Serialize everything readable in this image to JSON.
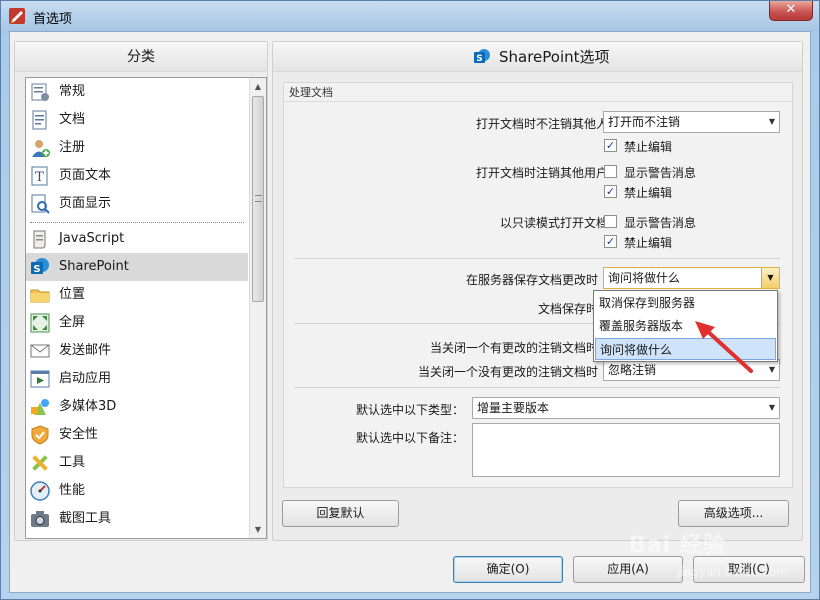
{
  "window": {
    "title": "首选项",
    "close_label": "✕"
  },
  "left": {
    "header": "分类",
    "items": [
      {
        "label": "常规",
        "icon": "settings-list-icon"
      },
      {
        "label": "文档",
        "icon": "document-icon"
      },
      {
        "label": "注册",
        "icon": "user-add-icon"
      },
      {
        "label": "页面文本",
        "icon": "text-icon"
      },
      {
        "label": "页面显示",
        "icon": "page-zoom-icon"
      },
      {
        "label": "JavaScript",
        "icon": "script-icon"
      },
      {
        "label": "SharePoint",
        "icon": "sharepoint-icon"
      },
      {
        "label": "位置",
        "icon": "folder-icon"
      },
      {
        "label": "全屏",
        "icon": "fullscreen-icon"
      },
      {
        "label": "发送邮件",
        "icon": "mail-icon"
      },
      {
        "label": "启动应用",
        "icon": "launch-app-icon"
      },
      {
        "label": "多媒体3D",
        "icon": "shapes-3d-icon"
      },
      {
        "label": "安全性",
        "icon": "shield-icon"
      },
      {
        "label": "工具",
        "icon": "tools-icon"
      },
      {
        "label": "性能",
        "icon": "gauge-icon"
      },
      {
        "label": "截图工具",
        "icon": "camera-icon"
      }
    ]
  },
  "right": {
    "header": "SharePoint选项",
    "group_title": "处理文档",
    "row1": {
      "label": "打开文档时不注销其他人",
      "value": "打开而不注销",
      "chk_label": "禁止编辑",
      "checked": true
    },
    "row2": {
      "label": "打开文档时注销其他用户",
      "chk1_label": "显示警告消息",
      "chk1": false,
      "chk2_label": "禁止编辑",
      "chk2": true
    },
    "row3": {
      "label": "以只读模式打开文档",
      "chk1_label": "显示警告消息",
      "chk1": false,
      "chk2_label": "禁止编辑",
      "chk2": true
    },
    "row4": {
      "label": "在服务器保存文档更改时",
      "value": "询问将做什么"
    },
    "row5": {
      "label": "文档保存时"
    },
    "row6": {
      "label": "当关闭一个有更改的注销文档时"
    },
    "row7": {
      "label": "当关闭一个没有更改的注销文档时",
      "value": "忽略注销"
    },
    "row8": {
      "label": "默认选中以下类型：",
      "value": "增量主要版本"
    },
    "row9": {
      "label": "默认选中以下备注："
    },
    "dropdown_options": [
      "取消保存到服务器",
      "覆盖服务器版本",
      "询问将做什么"
    ],
    "dropdown_selected": 2
  },
  "buttons": {
    "reset": "回复默认",
    "advanced": "高级选项...",
    "ok": "确定(O)",
    "apply": "应用(A)",
    "cancel": "取消(C)"
  },
  "watermark": {
    "main": "Bai 经验",
    "sub": "jingyan.baidu.com"
  },
  "colors": {
    "accent": "#3c7fb1",
    "sharepoint_blue": "#0b6bb5",
    "highlight": "#cfe3fb",
    "arrow_red": "#e03030"
  }
}
